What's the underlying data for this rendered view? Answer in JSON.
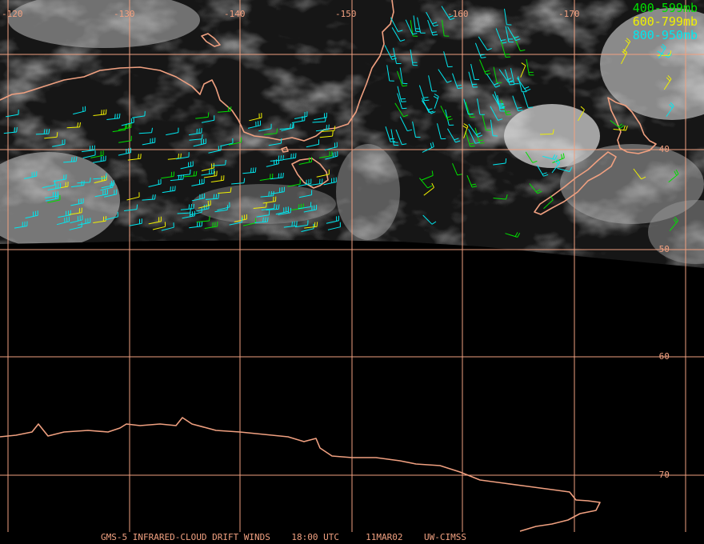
{
  "colors": {
    "grid": "#f0a080",
    "coast": "#f0a080",
    "band_high": "#00e000",
    "band_mid": "#f0f000",
    "band_low": "#00e8f0"
  },
  "legend": [
    {
      "label": "400-599mb",
      "color": "#00e000"
    },
    {
      "label": "600-799mb",
      "color": "#f0f000"
    },
    {
      "label": "800-950mb",
      "color": "#00e8f0"
    }
  ],
  "longitude_labels": [
    "-120",
    "-130",
    "-140",
    "-150",
    "-160",
    "-170"
  ],
  "latitude_labels": [
    "-40",
    "-50",
    "-60",
    "-70"
  ],
  "footer": {
    "title": "GMS-5 INFRARED-CLOUD DRIFT WINDS",
    "time": "18:00 UTC",
    "date": "11MAR02",
    "source": "UW-CIMSS"
  }
}
